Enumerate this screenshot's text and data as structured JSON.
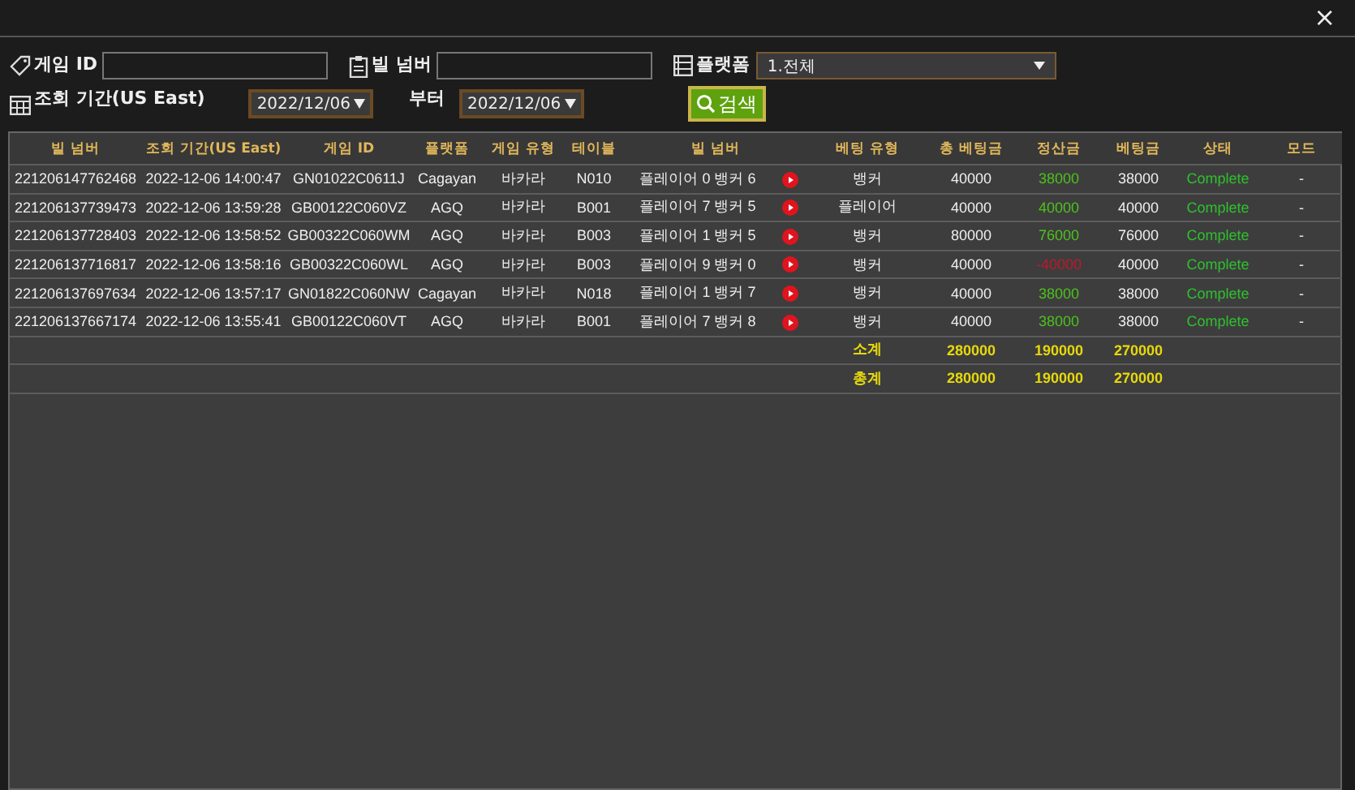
{
  "window": {
    "close": "×"
  },
  "filters": {
    "game_id": {
      "label": "게임 ID"
    },
    "bill_number": {
      "label": "빌 넘버"
    },
    "platform": {
      "label": "플랫폼",
      "value": "1.전체"
    },
    "period": {
      "label": "조회 기간(US East)",
      "from": "2022/12/06",
      "separator": "부터",
      "to": "2022/12/06"
    },
    "search_button": "검색"
  },
  "table": {
    "columns": [
      "빌 넘버",
      "조회 기간(US East)",
      "게임 ID",
      "플랫폼",
      "게임 유형",
      "테이블",
      "빌 넘버",
      "베팅 유형",
      "총 베팅금",
      "정산금",
      "베팅금",
      "상태",
      "모드"
    ],
    "rows": [
      {
        "bill": "221206147762468",
        "time": "2022-12-06 14:00:47",
        "game_id": "GN01022C0611J",
        "platform": "Cagayan",
        "game_type": "바카라",
        "table": "N010",
        "result": "플레이어 0 뱅커 6",
        "bet_type": "뱅커",
        "total_bet": "40000",
        "payout": {
          "value": "38000",
          "color": "#4cc21c"
        },
        "bet": "38000",
        "status": "Complete",
        "mode": "-"
      },
      {
        "bill": "221206137739473",
        "time": "2022-12-06 13:59:28",
        "game_id": "GB00122C060VZ",
        "platform": "AGQ",
        "game_type": "바카라",
        "table": "B001",
        "result": "플레이어 7 뱅커 5",
        "bet_type": "플레이어",
        "total_bet": "40000",
        "payout": {
          "value": "40000",
          "color": "#4cc21c"
        },
        "bet": "40000",
        "status": "Complete",
        "mode": "-"
      },
      {
        "bill": "221206137728403",
        "time": "2022-12-06 13:58:52",
        "game_id": "GB00322C060WM",
        "platform": "AGQ",
        "game_type": "바카라",
        "table": "B003",
        "result": "플레이어 1 뱅커 5",
        "bet_type": "뱅커",
        "total_bet": "80000",
        "payout": {
          "value": "76000",
          "color": "#4cc21c"
        },
        "bet": "76000",
        "status": "Complete",
        "mode": "-"
      },
      {
        "bill": "221206137716817",
        "time": "2022-12-06 13:58:16",
        "game_id": "GB00322C060WL",
        "platform": "AGQ",
        "game_type": "바카라",
        "table": "B003",
        "result": "플레이어 9 뱅커 0",
        "bet_type": "뱅커",
        "total_bet": "40000",
        "payout": {
          "value": "-40000",
          "color": "#c0182a"
        },
        "bet": "40000",
        "status": "Complete",
        "mode": "-"
      },
      {
        "bill": "221206137697634",
        "time": "2022-12-06 13:57:17",
        "game_id": "GN01822C060NW",
        "platform": "Cagayan",
        "game_type": "바카라",
        "table": "N018",
        "result": "플레이어 1 뱅커 7",
        "bet_type": "뱅커",
        "total_bet": "40000",
        "payout": {
          "value": "38000",
          "color": "#4cc21c"
        },
        "bet": "38000",
        "status": "Complete",
        "mode": "-"
      },
      {
        "bill": "221206137667174",
        "time": "2022-12-06 13:55:41",
        "game_id": "GB00122C060VT",
        "platform": "AGQ",
        "game_type": "바카라",
        "table": "B001",
        "result": "플레이어 7 뱅커 8",
        "bet_type": "뱅커",
        "total_bet": "40000",
        "payout": {
          "value": "38000",
          "color": "#4cc21c"
        },
        "bet": "38000",
        "status": "Complete",
        "mode": "-"
      }
    ],
    "totals": [
      {
        "label": "소계",
        "total_bet": "280000",
        "payout": "190000",
        "bet": "270000"
      },
      {
        "label": "총계",
        "total_bet": "280000",
        "payout": "190000",
        "bet": "270000"
      }
    ]
  }
}
